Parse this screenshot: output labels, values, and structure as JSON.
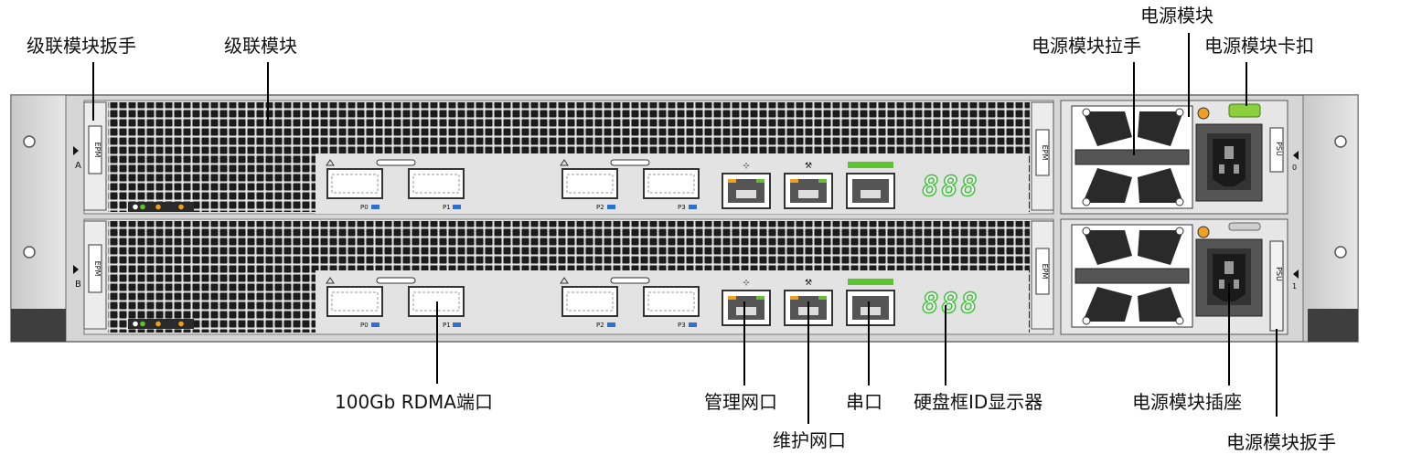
{
  "callouts": {
    "cascade_handle": "级联模块扳手",
    "cascade_module": "级联模块",
    "psu_module": "电源模块",
    "psu_pull_handle": "电源模块拉手",
    "psu_latch": "电源模块卡扣",
    "rdma_port": "100Gb RDMA端口",
    "mgmt_port": "管理网口",
    "maint_port": "维护网口",
    "serial_port": "串口",
    "enclosure_id_display": "硬盘框ID显示器",
    "psu_socket": "电源模块插座",
    "psu_handle": "电源模块扳手"
  },
  "panel": {
    "module_a_tag": "A",
    "module_b_tag": "B",
    "epm_label": "EPM",
    "psu_label": "PSU",
    "psu0_num": "0",
    "psu1_num": "1",
    "port_labels": [
      "P0",
      "P1",
      "P2",
      "P3"
    ],
    "id_display_value": "888"
  },
  "colors": {
    "chassis": "#d9d9d9",
    "chassis_dark": "#3a3a3a",
    "vent_hole": "#1c1c1c",
    "led_green": "#5fc230",
    "latch_green": "#8ccf3c",
    "led_amber": "#f0a020",
    "led_blue": "#2f6fd0",
    "display_green": "#3dc23a"
  }
}
